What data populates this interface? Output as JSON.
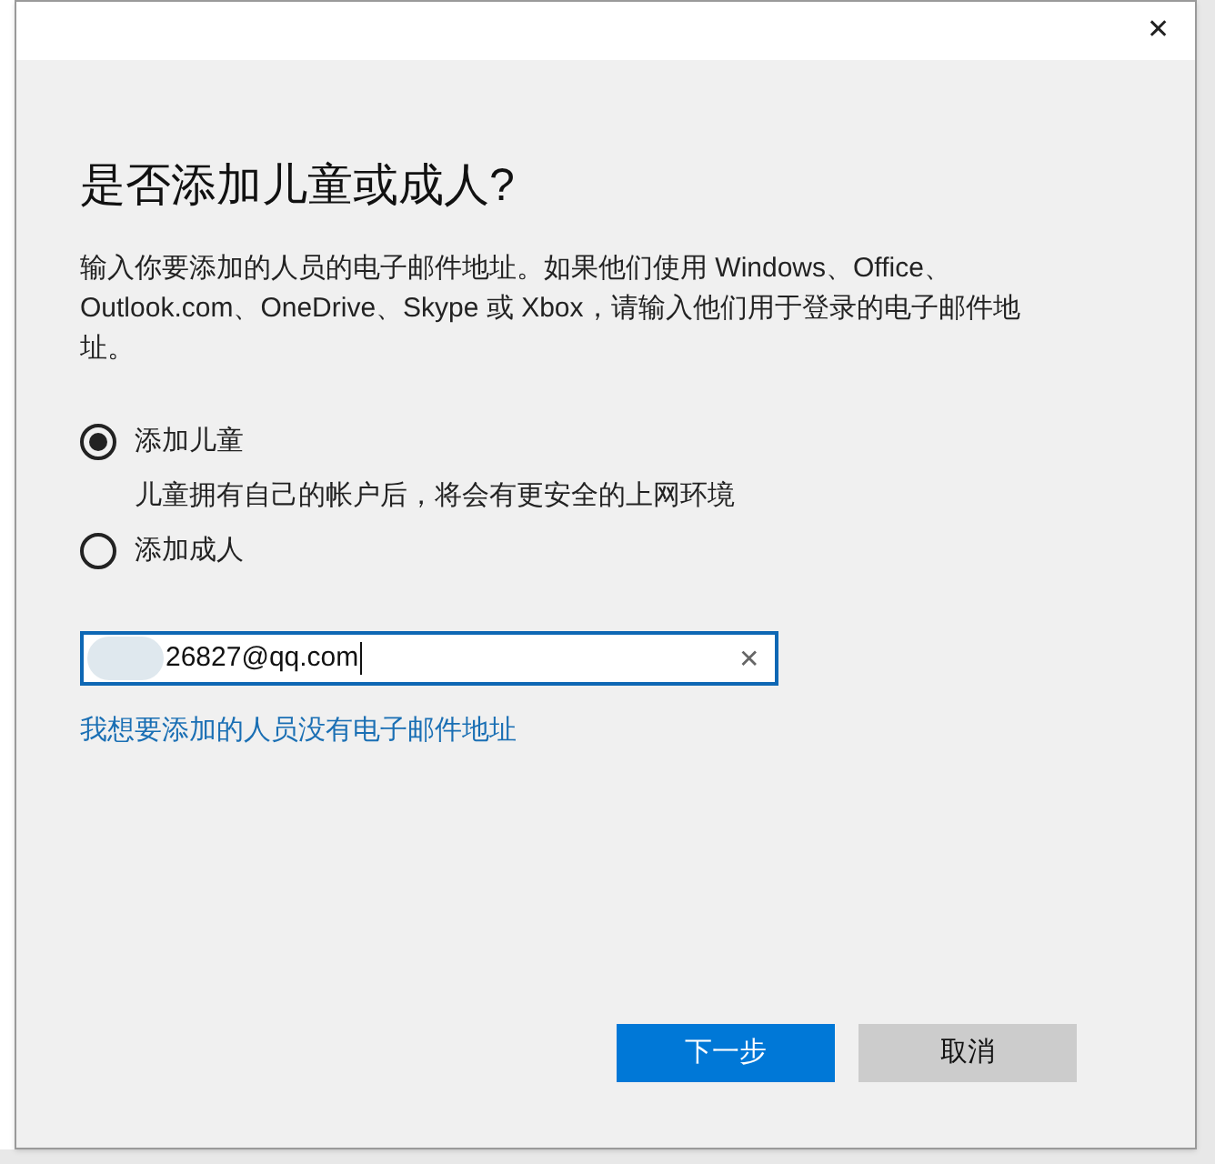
{
  "dialog": {
    "close": "✕",
    "title": "是否添加儿童或成人?",
    "description": "输入你要添加的人员的电子邮件地址。如果他们使用 Windows、Office、Outlook.com、OneDrive、Skype 或 Xbox，请输入他们用于登录的电子邮件地址。",
    "options": [
      {
        "label": "添加儿童",
        "selected": true,
        "note": "儿童拥有自己的帐户后，将会有更安全的上网环境"
      },
      {
        "label": "添加成人",
        "selected": false
      }
    ],
    "email": {
      "value": "26827@qq.com",
      "redacted": true,
      "clear": "✕"
    },
    "link": "我想要添加的人员没有电子邮件地址",
    "buttons": [
      {
        "label": "下一步",
        "kind": "primary"
      },
      {
        "label": "取消",
        "kind": "secondary"
      }
    ]
  }
}
